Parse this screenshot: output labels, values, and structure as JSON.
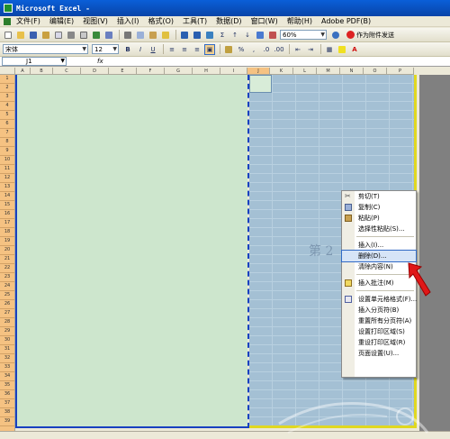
{
  "window": {
    "title": "Microsoft Excel -"
  },
  "menu": {
    "items": [
      "文件(F)",
      "编辑(E)",
      "视图(V)",
      "插入(I)",
      "格式(O)",
      "工具(T)",
      "数据(D)",
      "窗口(W)",
      "帮助(H)",
      "Adobe PDF(B)"
    ]
  },
  "toolbar": {
    "zoom": "60%",
    "send_label": "作为附件发送",
    "font_name": "宋体",
    "font_size": "12",
    "bold": "B",
    "italic": "I",
    "underline": "U"
  },
  "formula_bar": {
    "name_box": "J1",
    "fx_label": "fx",
    "content": ""
  },
  "columns": [
    "A",
    "B",
    "C",
    "D",
    "E",
    "F",
    "G",
    "H",
    "I",
    "J",
    "K",
    "L",
    "M",
    "N",
    "O",
    "P"
  ],
  "rows": [
    "1",
    "2",
    "3",
    "4",
    "5",
    "6",
    "7",
    "8",
    "9",
    "10",
    "11",
    "12",
    "13",
    "14",
    "15",
    "16",
    "17",
    "18",
    "19",
    "20",
    "21",
    "22",
    "23",
    "24",
    "25",
    "26",
    "27",
    "28",
    "29",
    "30",
    "31",
    "32",
    "33",
    "34",
    "35",
    "36",
    "37",
    "38",
    "39"
  ],
  "sheet": {
    "page2_label": "第 2"
  },
  "context_menu": {
    "items": [
      {
        "label": "剪切(T)",
        "icon": "scissors-icon"
      },
      {
        "label": "复制(C)",
        "icon": "copy-icon"
      },
      {
        "label": "粘贴(P)",
        "icon": "paste-icon"
      },
      {
        "label": "选择性粘贴(S)...",
        "icon": ""
      },
      {
        "label": "插入(I)...",
        "icon": ""
      },
      {
        "label": "删除(D)...",
        "icon": "",
        "highlighted": true
      },
      {
        "label": "清除内容(N)",
        "icon": ""
      },
      {
        "label": "插入批注(M)",
        "icon": "comment-icon"
      },
      {
        "label": "设置单元格格式(F)...",
        "icon": "format-cells-icon"
      },
      {
        "label": "插入分页符(B)",
        "icon": ""
      },
      {
        "label": "重置所有分页符(A)",
        "icon": ""
      },
      {
        "label": "设置打印区域(S)",
        "icon": ""
      },
      {
        "label": "重设打印区域(R)",
        "icon": ""
      },
      {
        "label": "页面设置(U)...",
        "icon": ""
      }
    ]
  },
  "colors": {
    "page1_bg": "#cde6cd",
    "page2_bg": "#a4c0d4",
    "selected_header": "#f5c282",
    "arrow": "#e01818"
  }
}
